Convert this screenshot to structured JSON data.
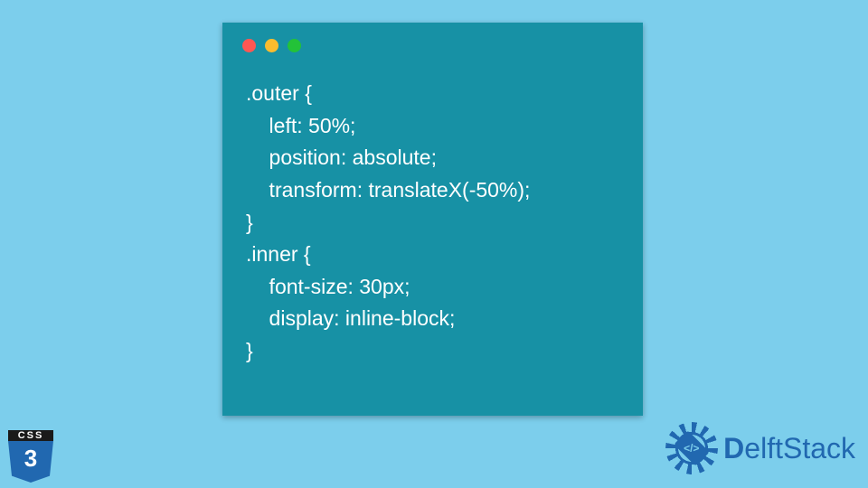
{
  "code": {
    "lines": [
      ".outer {",
      "    left: 50%;",
      "    position: absolute;",
      "    transform: translateX(-50%);",
      "}",
      ".inner {",
      "    font-size: 30px;",
      "    display: inline-block;",
      "}"
    ]
  },
  "css_badge": {
    "top_label": "CSS",
    "number": "3"
  },
  "brand": {
    "gear_glyph": "</>",
    "bold_part": "D",
    "rest_part": "elftStack"
  },
  "colors": {
    "page_bg": "#7cceec",
    "window_bg": "#1791a5",
    "code_text": "#ffffff",
    "brand_blue": "#2168b0",
    "dot_red": "#ff5753",
    "dot_yellow": "#fabc2e",
    "dot_green": "#23c238"
  }
}
